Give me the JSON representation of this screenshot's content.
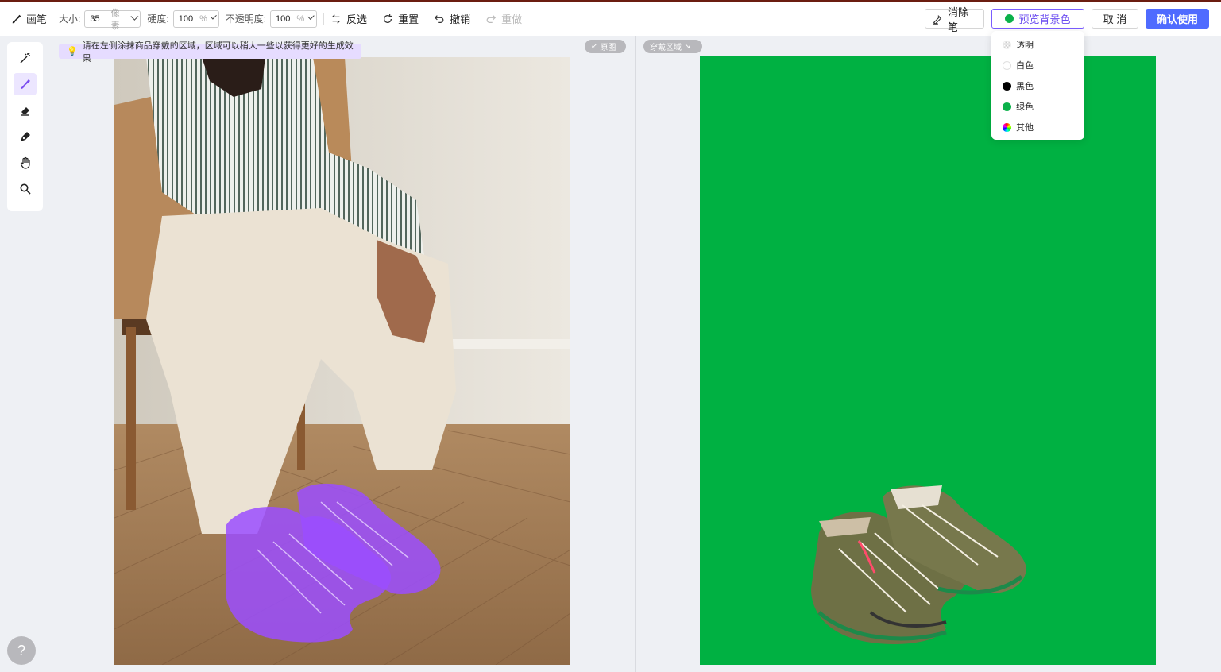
{
  "toolbar": {
    "brush_label": "画笔",
    "size_label": "大小:",
    "size_value": "35",
    "size_unit": "像素",
    "hardness_label": "硬度:",
    "hardness_value": "100",
    "hardness_unit": "%",
    "opacity_label": "不透明度:",
    "opacity_value": "100",
    "opacity_unit": "%",
    "invert_label": "反选",
    "reset_label": "重置",
    "undo_label": "撤销",
    "redo_label": "重做"
  },
  "actions": {
    "eraser_label": "消除笔",
    "preview_bg_label": "预览背景色",
    "cancel_label": "取 消",
    "confirm_label": "确认使用"
  },
  "bg_menu": {
    "items": [
      {
        "label": "透明",
        "swatch": "transparent"
      },
      {
        "label": "白色",
        "swatch": "#ffffff"
      },
      {
        "label": "黑色",
        "swatch": "#000000"
      },
      {
        "label": "绿色",
        "swatch": "#0bb14a"
      },
      {
        "label": "其他",
        "swatch": "multicolor"
      }
    ]
  },
  "tools": [
    {
      "name": "magic-wand"
    },
    {
      "name": "brush",
      "active": true
    },
    {
      "name": "eraser"
    },
    {
      "name": "pen"
    },
    {
      "name": "hand"
    },
    {
      "name": "zoom"
    }
  ],
  "canvas": {
    "tip": "请在左侧涂抹商品穿戴的区域，区域可以稍大一些以获得更好的生成效果",
    "original_chip": "原图",
    "wear_chip": "穿戴区域",
    "preview_bg_color": "#00b142",
    "mask_color": "#9b4dff"
  },
  "help": {
    "label": "?"
  }
}
